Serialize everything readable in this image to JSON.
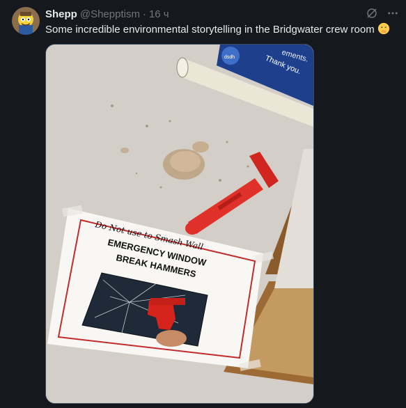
{
  "tweet": {
    "display_name": "Shepp",
    "handle": "@Shepptism",
    "separator": "·",
    "time": "16 ч",
    "text": "Some incredible environmental storytelling in the Bridgwater crew room",
    "emoji_name": "face-with-hand-over-mouth-emoji"
  },
  "photo": {
    "sign_handwriting": "Do Not use to Smash Wall",
    "sign_title_line1": "EMERGENCY WINDOW",
    "sign_title_line2": "BREAK HAMMERS",
    "card_text_1": "ements.",
    "card_text_2": "Thank you.",
    "card_logo_text": "dsdh"
  },
  "icons": {
    "grok": "grok-icon",
    "more": "more-icon"
  }
}
